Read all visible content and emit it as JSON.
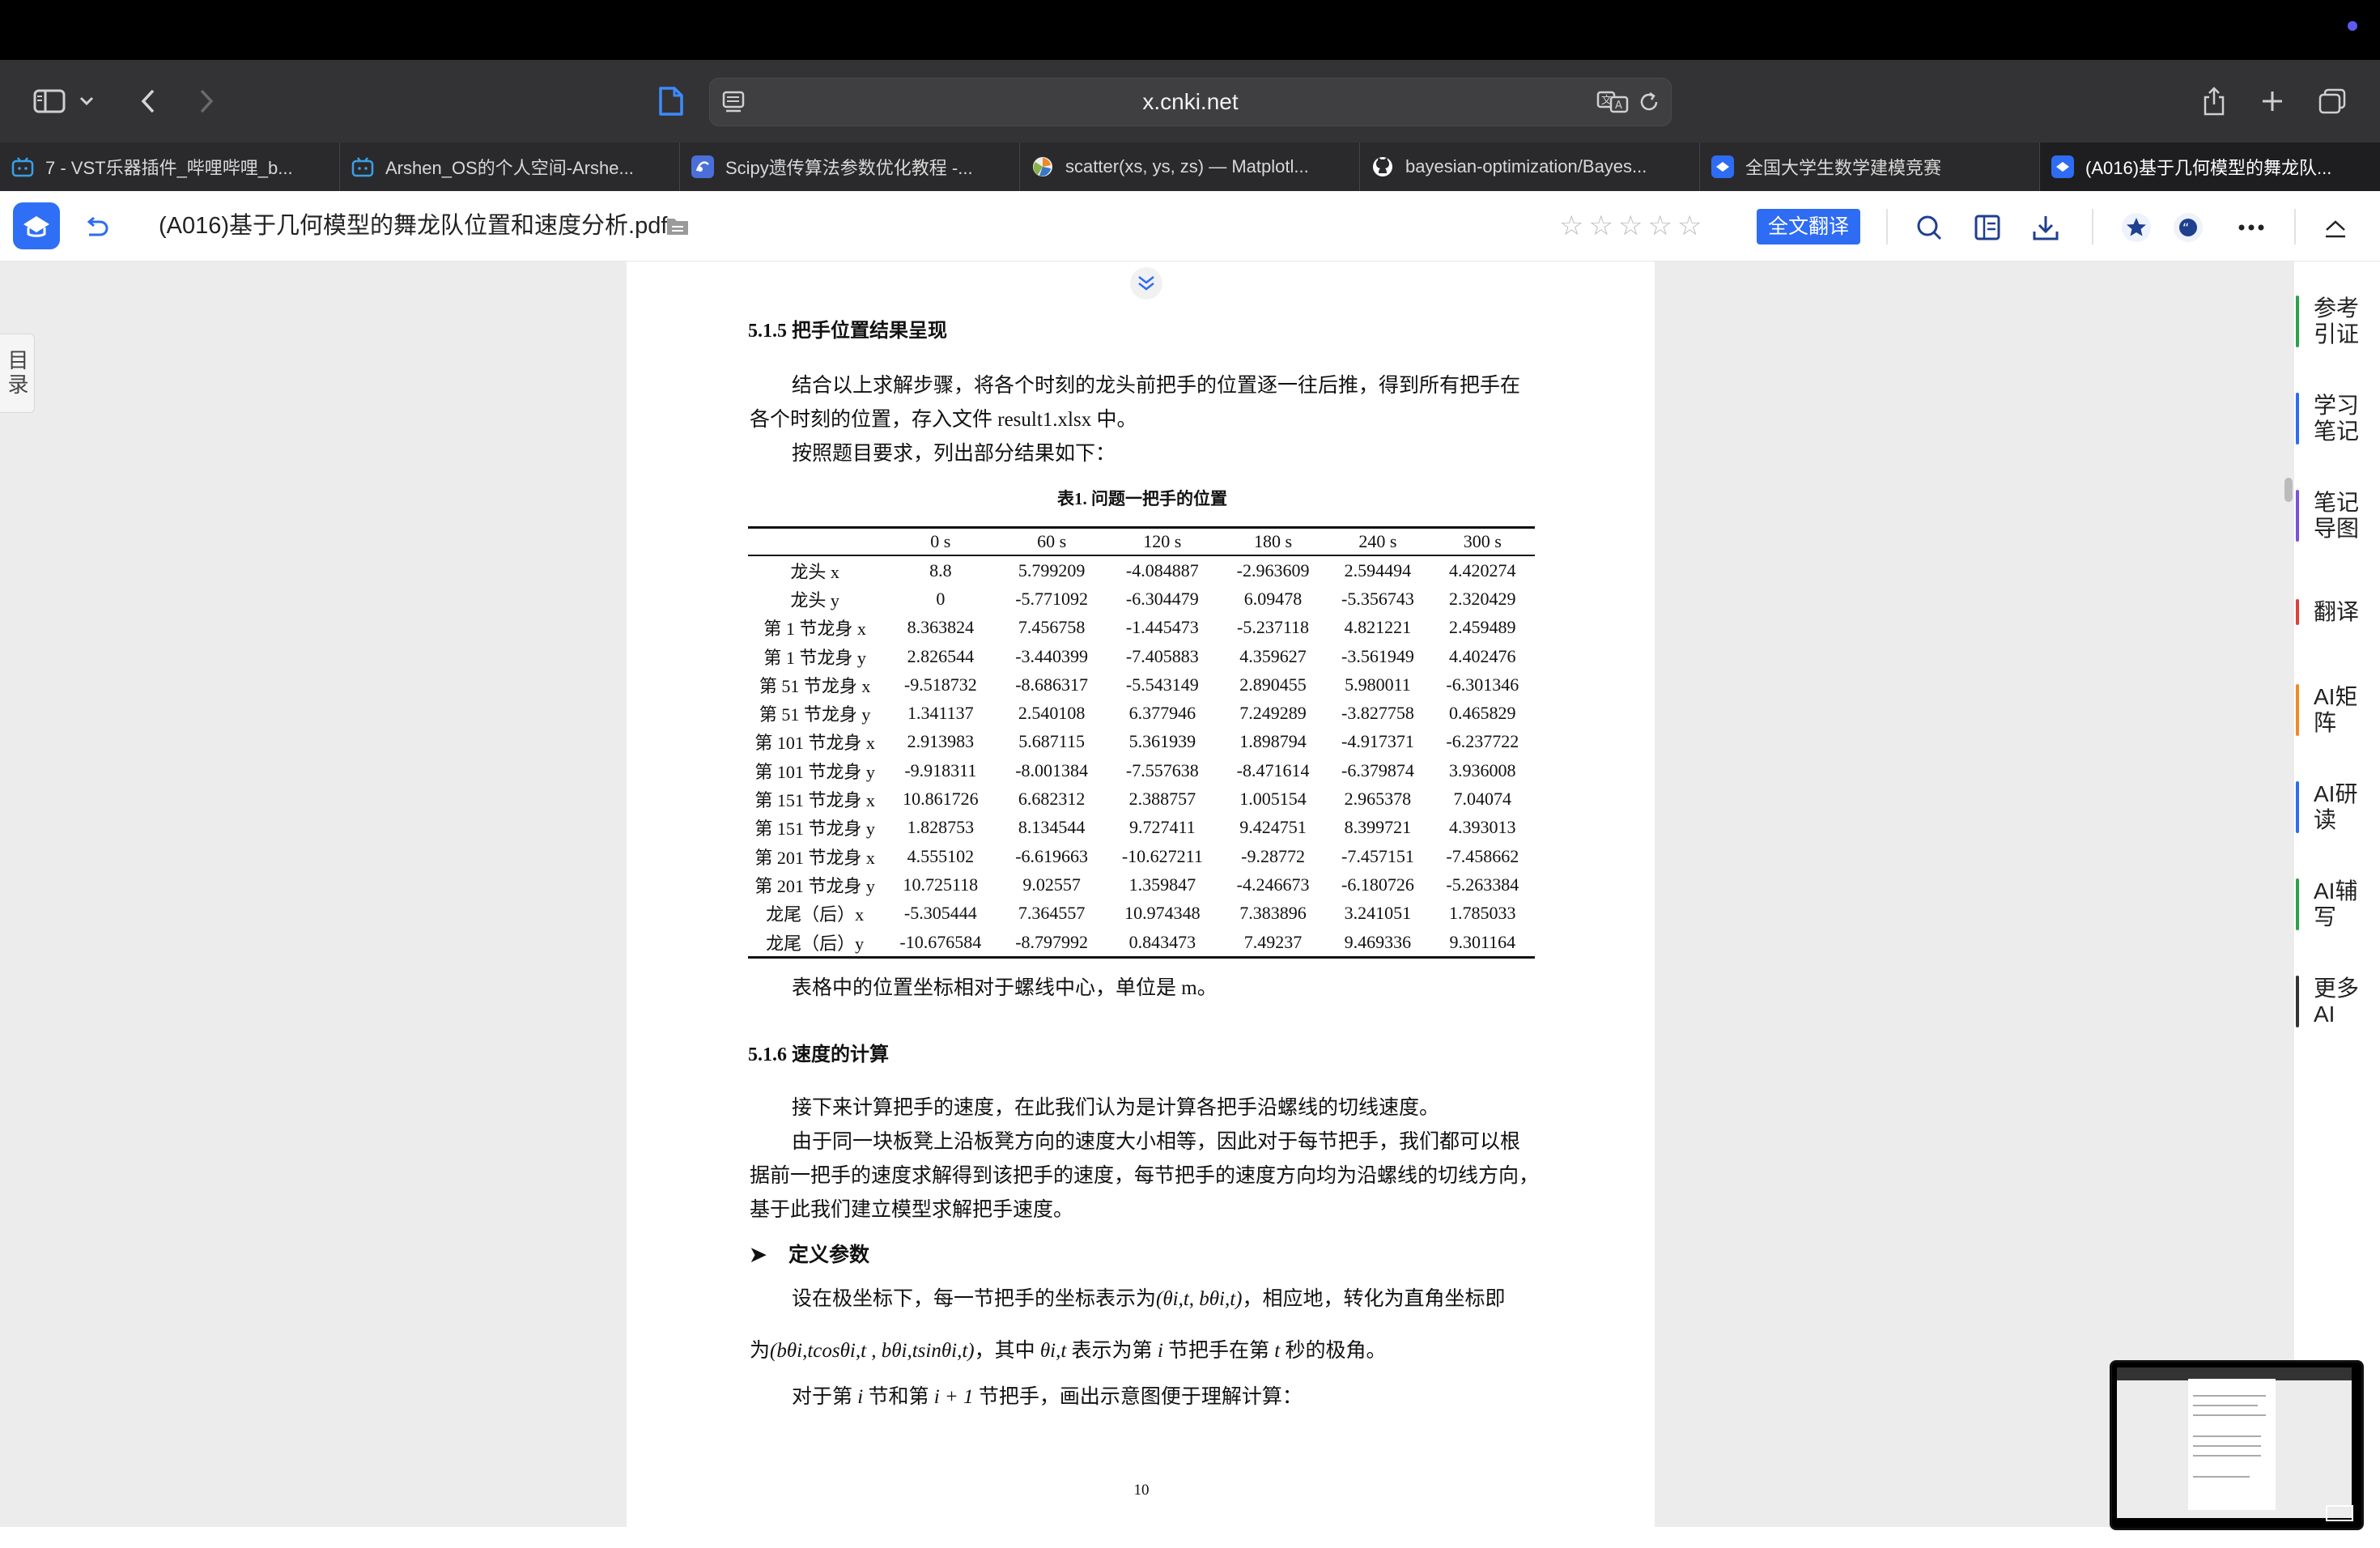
{
  "browser": {
    "url": "x.cnki.net",
    "tabs": [
      {
        "label": "7 - VST乐器插件_哔哩哔哩_b...",
        "icon": "bilibili-icon",
        "active": false
      },
      {
        "label": "Arshen_OS的个人空间-Arshe...",
        "icon": "bilibili-icon",
        "active": false
      },
      {
        "label": "Scipy遗传算法参数优化教程 -...",
        "icon": "scipy-icon",
        "active": false
      },
      {
        "label": "scatter(xs, ys, zs) — Matplotl...",
        "icon": "matplotlib-icon",
        "active": false
      },
      {
        "label": "bayesian-optimization/Bayes...",
        "icon": "github-icon",
        "active": false
      },
      {
        "label": "全国大学生数学建模竞赛",
        "icon": "cnki-icon",
        "active": false
      },
      {
        "label": "(A016)基于几何模型的舞龙队...",
        "icon": "cnki-icon",
        "active": true
      }
    ]
  },
  "reader": {
    "doc_title": "(A016)基于几何模型的舞龙队位置和速度分析.pdf",
    "translate_label": "全文翻译",
    "rating_stars": 0,
    "toc_label": "目录",
    "sidebar": [
      {
        "label": "参考引证",
        "color": "#2aa34a"
      },
      {
        "label": "学习笔记",
        "color": "#2e6cf3"
      },
      {
        "label": "笔记导图",
        "color": "#7b4fe0"
      },
      {
        "label": "翻译",
        "color": "#e0403a"
      },
      {
        "label": "AI矩阵",
        "color": "#f08a24"
      },
      {
        "label": "AI研读",
        "color": "#2e6cf3"
      },
      {
        "label": "AI辅写",
        "color": "#2aa34a"
      },
      {
        "label": "更多AI",
        "color": "#333333"
      }
    ]
  },
  "paper": {
    "section_515": "5.1.5 把手位置结果呈现",
    "p1_line1": "结合以上求解步骤，将各个时刻的龙头前把手的位置逐一往后推，得到所有把手在",
    "p1_line2": "各个时刻的位置，存入文件 result1.xlsx 中。",
    "p2": "按照题目要求，列出部分结果如下：",
    "table_caption": "表1. 问题一把手的位置",
    "table_headers": [
      "",
      "0 s",
      "60 s",
      "120 s",
      "180 s",
      "240 s",
      "300 s"
    ],
    "table_rows": [
      [
        "龙头 x",
        "8.8",
        "5.799209",
        "-4.084887",
        "-2.963609",
        "2.594494",
        "4.420274"
      ],
      [
        "龙头 y",
        "0",
        "-5.771092",
        "-6.304479",
        "6.09478",
        "-5.356743",
        "2.320429"
      ],
      [
        "第 1 节龙身 x",
        "8.363824",
        "7.456758",
        "-1.445473",
        "-5.237118",
        "4.821221",
        "2.459489"
      ],
      [
        "第 1 节龙身 y",
        "2.826544",
        "-3.440399",
        "-7.405883",
        "4.359627",
        "-3.561949",
        "4.402476"
      ],
      [
        "第 51 节龙身 x",
        "-9.518732",
        "-8.686317",
        "-5.543149",
        "2.890455",
        "5.980011",
        "-6.301346"
      ],
      [
        "第 51 节龙身 y",
        "1.341137",
        "2.540108",
        "6.377946",
        "7.249289",
        "-3.827758",
        "0.465829"
      ],
      [
        "第 101 节龙身 x",
        "2.913983",
        "5.687115",
        "5.361939",
        "1.898794",
        "-4.917371",
        "-6.237722"
      ],
      [
        "第 101 节龙身 y",
        "-9.918311",
        "-8.001384",
        "-7.557638",
        "-8.471614",
        "-6.379874",
        "3.936008"
      ],
      [
        "第 151 节龙身 x",
        "10.861726",
        "6.682312",
        "2.388757",
        "1.005154",
        "2.965378",
        "7.04074"
      ],
      [
        "第 151 节龙身 y",
        "1.828753",
        "8.134544",
        "9.727411",
        "9.424751",
        "8.399721",
        "4.393013"
      ],
      [
        "第 201 节龙身 x",
        "4.555102",
        "-6.619663",
        "-10.627211",
        "-9.28772",
        "-7.457151",
        "-7.458662"
      ],
      [
        "第 201 节龙身 y",
        "10.725118",
        "9.02557",
        "1.359847",
        "-4.246673",
        "-6.180726",
        "-5.263384"
      ],
      [
        "龙尾（后）x",
        "-5.305444",
        "7.364557",
        "10.974348",
        "7.383896",
        "3.241051",
        "1.785033"
      ],
      [
        "龙尾（后）y",
        "-10.676584",
        "-8.797992",
        "0.843473",
        "7.49237",
        "9.469336",
        "9.301164"
      ]
    ],
    "table_note": "表格中的位置坐标相对于螺线中心，单位是 m。",
    "section_516": "5.1.6 速度的计算",
    "p3": "接下来计算把手的速度，在此我们认为是计算各把手沿螺线的切线速度。",
    "p4_line1": "由于同一块板凳上沿板凳方向的速度大小相等，因此对于每节把手，我们都可以根",
    "p4_line2": "据前一把手的速度求解得到该把手的速度，每节把手的速度方向均为沿螺线的切线方向，",
    "p4_line3": "基于此我们建立模型求解把手速度。",
    "bullet_head": "定义参数",
    "p5_a": "设在极坐标下，每一节把手的坐标表示为",
    "p5_math": "(θi,t, bθi,t)",
    "p5_b": "，相应地，转化为直角坐标即",
    "p6_a": "为",
    "p6_math": "(bθi,tcosθi,t , bθi,tsinθi,t)",
    "p6_b": "，其中",
    "p6_math2": "θi,t",
    "p6_c": "表示为第",
    "p6_i": "i",
    "p6_d": "节把手在第",
    "p6_t": "t",
    "p6_e": "秒的极角。",
    "p7_a": "对于第",
    "p7_i": "i",
    "p7_b": "节和第",
    "p7_i1": "i + 1",
    "p7_c": "节把手，画出示意图便于理解计算：",
    "page_number": "10"
  }
}
